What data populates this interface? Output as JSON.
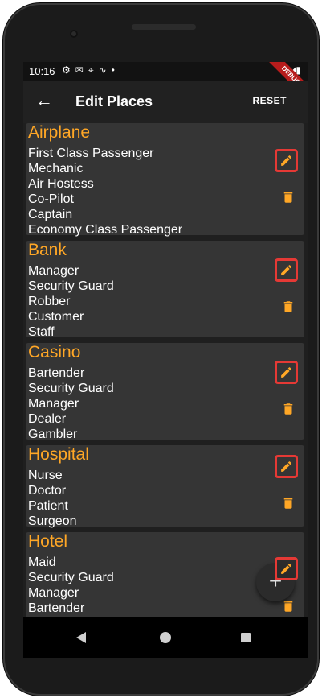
{
  "status_bar": {
    "time": "10:16",
    "icons": [
      "gear-icon",
      "mail-icon",
      "location-icon",
      "signal-wave-icon",
      "dot-icon"
    ],
    "right_icons": [
      "wifi-icon",
      "cell-icon",
      "battery-icon"
    ],
    "debug_banner": "DEBUG"
  },
  "app_bar": {
    "title": "Edit Places",
    "action": "RESET"
  },
  "places": [
    {
      "name": "Airplane",
      "roles": [
        "First Class Passenger",
        "Mechanic",
        "Air Hostess",
        "Co-Pilot",
        "Captain",
        "Economy Class Passenger"
      ]
    },
    {
      "name": "Bank",
      "roles": [
        "Manager",
        "Security Guard",
        "Robber",
        "Customer",
        "Staff"
      ]
    },
    {
      "name": "Casino",
      "roles": [
        "Bartender",
        "Security Guard",
        "Manager",
        "Dealer",
        "Gambler"
      ]
    },
    {
      "name": "Hospital",
      "roles": [
        "Nurse",
        "Doctor",
        "Patient",
        "Surgeon"
      ]
    },
    {
      "name": "Hotel",
      "roles": [
        "Maid",
        "Security Guard",
        "Manager",
        "Bartender"
      ]
    }
  ],
  "fab": {
    "icon": "add-icon",
    "label": "+"
  },
  "colors": {
    "accent": "#ffa726",
    "card": "#353535",
    "background": "#1f1f1f",
    "highlight": "#e53935"
  }
}
